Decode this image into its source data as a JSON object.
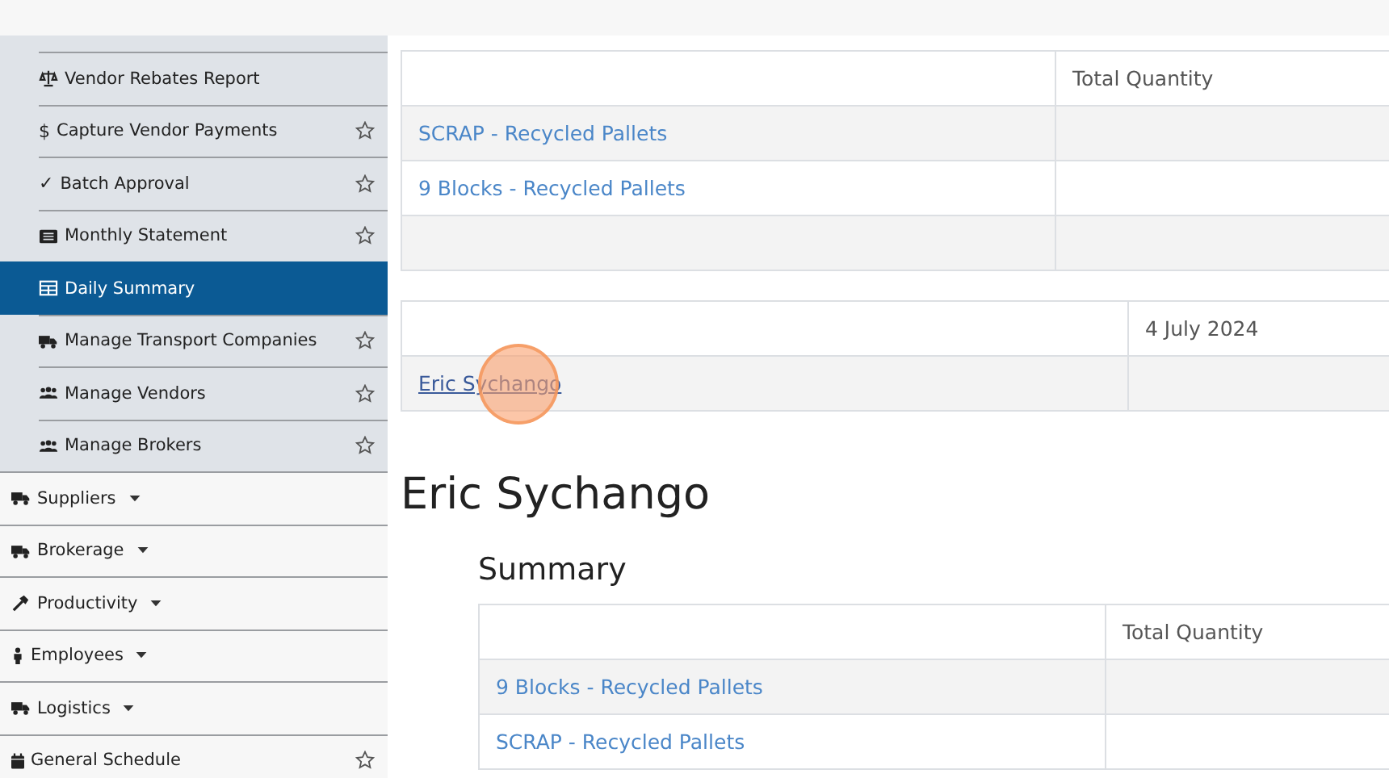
{
  "sidebar": {
    "sub_items": [
      {
        "label": "Vendor Rebates Report",
        "selected": false,
        "has_star": false
      },
      {
        "label": "Capture Vendor Payments",
        "glyph": "$",
        "selected": false,
        "has_star": true
      },
      {
        "label": "Batch Approval",
        "glyph": "✓",
        "selected": false,
        "has_star": true
      },
      {
        "label": "Monthly Statement",
        "selected": false,
        "has_star": true
      },
      {
        "label": "Daily Summary",
        "selected": true,
        "has_star": false
      },
      {
        "label": "Manage Transport Companies",
        "selected": false,
        "has_star": true
      },
      {
        "label": "Manage Vendors",
        "selected": false,
        "has_star": true
      },
      {
        "label": "Manage Brokers",
        "selected": false,
        "has_star": true
      }
    ],
    "items": [
      {
        "label": "Suppliers",
        "has_caret": true,
        "has_star": false
      },
      {
        "label": "Brokerage",
        "has_caret": true,
        "has_star": false
      },
      {
        "label": "Productivity",
        "has_caret": true,
        "has_star": false
      },
      {
        "label": "Employees",
        "has_caret": true,
        "has_star": false
      },
      {
        "label": "Logistics",
        "has_caret": true,
        "has_star": false
      },
      {
        "label": "General Schedule",
        "has_caret": false,
        "has_star": true
      }
    ]
  },
  "products_table": {
    "columns": [
      "",
      "Total Quantity"
    ],
    "rows": [
      [
        "SCRAP - Recycled Pallets",
        ""
      ],
      [
        "9 Blocks - Recycled Pallets",
        ""
      ],
      [
        "",
        ""
      ]
    ]
  },
  "daily_table": {
    "columns": [
      "",
      "4 July 2024"
    ],
    "rows": [
      [
        "Eric Sychango",
        ""
      ]
    ]
  },
  "person": {
    "name": "Eric Sychango",
    "section": "Summary",
    "table": {
      "columns": [
        "",
        "Total Quantity"
      ],
      "rows": [
        [
          "9 Blocks - Recycled Pallets",
          ""
        ],
        [
          "SCRAP - Recycled Pallets",
          ""
        ]
      ]
    }
  }
}
